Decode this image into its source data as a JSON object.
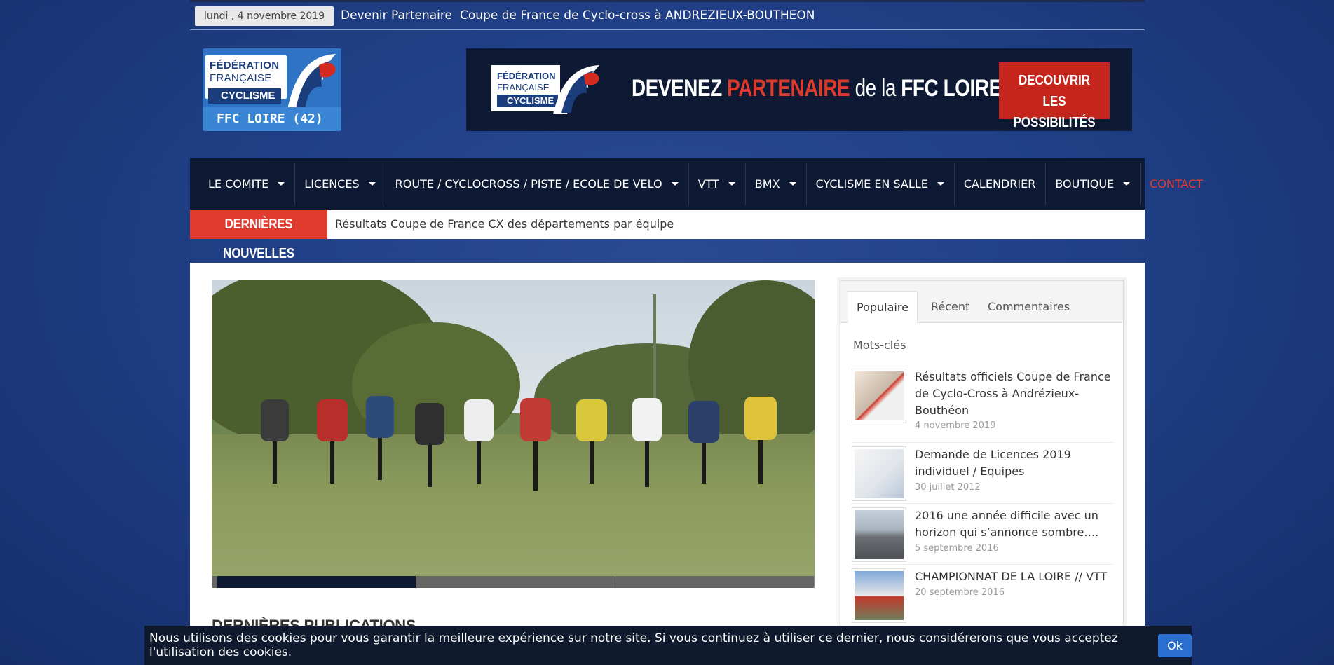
{
  "topbar": {
    "date": "lundi , 4 novembre 2019",
    "links": [
      "Devenir Partenaire",
      "Coupe de France de Cyclo-cross à ANDREZIEUX-BOUTHEON"
    ]
  },
  "logo": {
    "line1": "FÉDÉRATION",
    "line2": "FRANÇAISE",
    "line3": "CYCLISME",
    "line4": "FFC LOIRE (42)"
  },
  "banner": {
    "logo_line1": "FÉDÉRATION",
    "logo_line2": "FRANÇAISE",
    "logo_line3": "CYCLISME",
    "headline_a": "DEVENEZ ",
    "headline_b": "PARTENAIRE",
    "headline_c": " de la ",
    "headline_d": "FFC LOIRE",
    "cta_line1": "DECOUVRIR",
    "cta_line2": "LES POSSIBILITÉS"
  },
  "nav": {
    "items": [
      {
        "label": "LE COMITE",
        "dropdown": true
      },
      {
        "label": "LICENCES",
        "dropdown": true
      },
      {
        "label": "ROUTE / CYCLOCROSS / PISTE / ECOLE DE VELO",
        "dropdown": true
      },
      {
        "label": "VTT",
        "dropdown": true
      },
      {
        "label": "BMX",
        "dropdown": true
      },
      {
        "label": "CYCLISME EN SALLE",
        "dropdown": true
      },
      {
        "label": "CALENDRIER",
        "dropdown": false
      },
      {
        "label": "BOUTIQUE",
        "dropdown": true
      },
      {
        "label": "CONTACT",
        "dropdown": false
      }
    ]
  },
  "news": {
    "label": "DERNIÈRES NOUVELLES",
    "headline": "Résultats Coupe de France CX des départements par équipe"
  },
  "main": {
    "section_title": "DERNIÈRES PUBLICATIONS"
  },
  "sidebar": {
    "tabs": [
      "Populaire",
      "Récent",
      "Commentaires"
    ],
    "tags_label": "Mots-clés",
    "posts": [
      {
        "title": "Résultats officiels Coupe de France de Cyclo-Cross à Andrézieux-Bouthéon",
        "date": "4 novembre 2019"
      },
      {
        "title": "Demande de Licences 2019 individuel / Equipes",
        "date": "30 juillet 2012"
      },
      {
        "title": "2016 une année difficile avec un horizon qui s’annonce sombre….",
        "date": "5 septembre 2016"
      },
      {
        "title": "CHAMPIONNAT DE LA LOIRE // VTT",
        "date": "20 septembre 2016"
      }
    ]
  },
  "cookie": {
    "text": "Nous utilisons des cookies pour vous garantir la meilleure expérience sur notre site. Si vous continuez à utiliser ce dernier, nous considérerons que vous acceptez l'utilisation des cookies.",
    "button": "Ok"
  }
}
